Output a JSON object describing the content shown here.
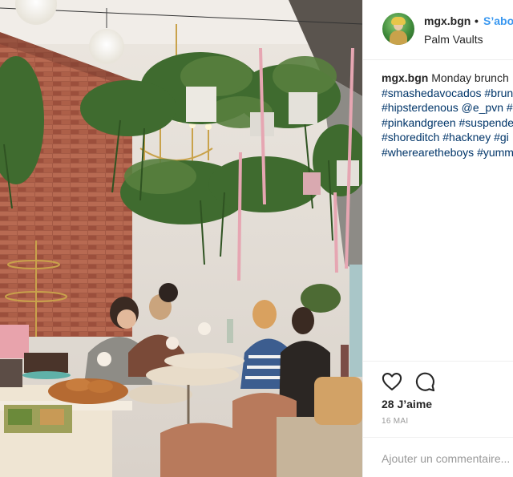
{
  "post": {
    "username": "mgx.bgn",
    "separator": "•",
    "follow_label": "S’abo",
    "location": "Palm Vaults"
  },
  "caption": {
    "author": "mgx.bgn",
    "text": "Monday brunch",
    "lines": [
      "#smashedavocados #brun",
      "#hipsterdenous @e_pvn #",
      "#pinkandgreen #suspende",
      "#shoreditch #hackney #gi",
      "#wherearetheboys #yumm"
    ]
  },
  "actions": {
    "likes": "28 J’aime",
    "date": "16 MAI"
  },
  "comment": {
    "placeholder": "Ajouter un commentaire..."
  },
  "icons": [
    "heart-icon",
    "comment-icon"
  ],
  "colors": {
    "link_blue": "#3897f0",
    "hashtag": "#003569",
    "text": "#262626",
    "muted": "#999999"
  }
}
